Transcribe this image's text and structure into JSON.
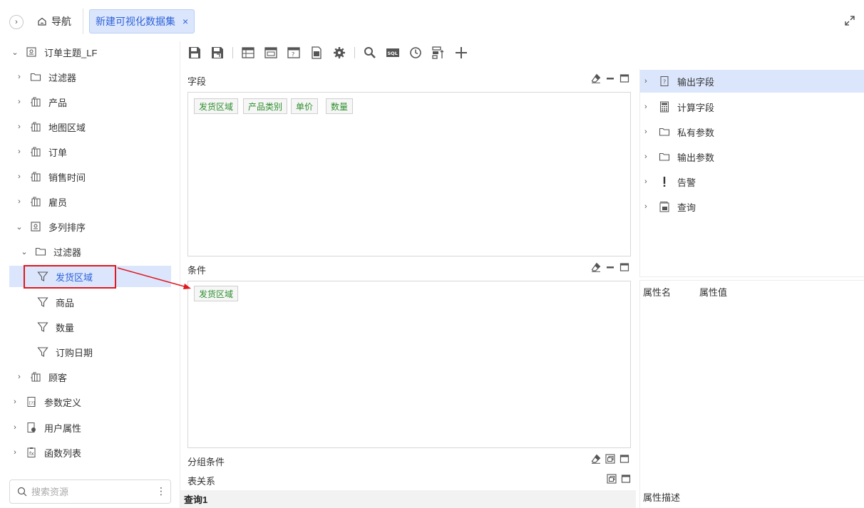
{
  "topbar": {
    "nav_label": "导航",
    "tab_label": "新建可视化数据集",
    "tab_close": "×"
  },
  "tree": {
    "root": "订单主题_LF",
    "items": [
      {
        "label": "过滤器"
      },
      {
        "label": "产品"
      },
      {
        "label": "地图区域"
      },
      {
        "label": "订单"
      },
      {
        "label": "销售时间"
      },
      {
        "label": "雇员"
      },
      {
        "label": "多列排序"
      },
      {
        "label": "过滤器"
      },
      {
        "label": "发货区域"
      },
      {
        "label": "商品"
      },
      {
        "label": "数量"
      },
      {
        "label": "订购日期"
      },
      {
        "label": "顾客"
      },
      {
        "label": "参数定义"
      },
      {
        "label": "用户属性"
      },
      {
        "label": "函数列表"
      }
    ]
  },
  "search": {
    "placeholder": "搜索资源",
    "more": "⋮"
  },
  "center": {
    "fields_label": "字段",
    "fields_chips": [
      "发货区域",
      "产品类别",
      "单价",
      "数量"
    ],
    "conditions_label": "条件",
    "conditions_chips": [
      "发货区域"
    ],
    "group_label": "分组条件",
    "relation_label": "表关系",
    "query_tab": "查询1"
  },
  "right": {
    "items": [
      {
        "label": "输出字段"
      },
      {
        "label": "计算字段"
      },
      {
        "label": "私有参数"
      },
      {
        "label": "输出参数"
      },
      {
        "label": "告警"
      },
      {
        "label": "查询"
      }
    ],
    "prop_name": "属性名",
    "prop_value": "属性值",
    "prop_desc": "属性描述"
  },
  "colors": {
    "accent": "#2f63d8",
    "selected_bg": "#dbe6fd",
    "highlight_red": "#e0181f",
    "chip_text": "#2f8f2f"
  }
}
